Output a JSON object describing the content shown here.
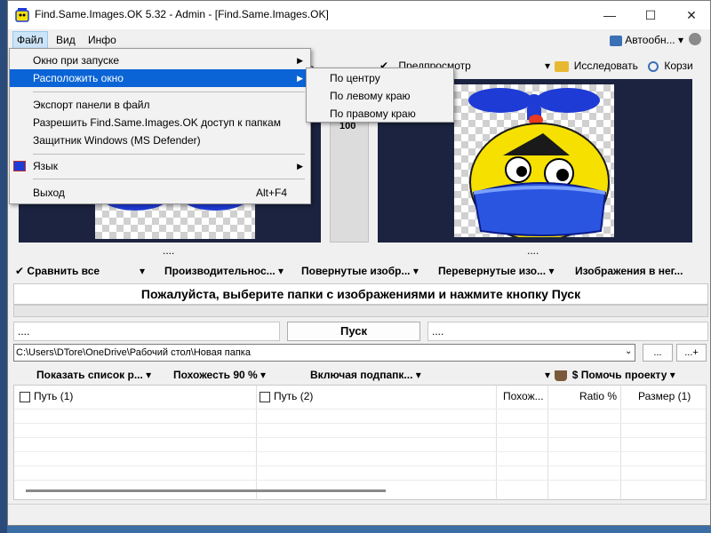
{
  "window": {
    "title": "Find.Same.Images.OK 5.32 - Admin - [Find.Same.Images.OK]"
  },
  "window_controls": {
    "minimize": "—",
    "maximize": "☐",
    "close": "✕"
  },
  "menubar": {
    "items": [
      "Файл",
      "Вид",
      "Инфо"
    ],
    "right": {
      "autoupdate_label": "Автообн...",
      "arrow": "▾"
    }
  },
  "toolbar": {
    "left_partial": "ь",
    "preview_check": "✔",
    "preview_label": "Предпросмотр",
    "explore_arrow": "▾",
    "explore_label": "Исследовать",
    "recycle_label": "Корзи"
  },
  "panels": {
    "left_dots": "....",
    "right_dots": "....",
    "middle_label": "100"
  },
  "options_bar": {
    "items": [
      {
        "label": "Сравнить все",
        "check": "✔"
      },
      {
        "label": "Производительнос..."
      },
      {
        "label": "Повернутые изобр..."
      },
      {
        "label": "Перевернутые изо..."
      },
      {
        "label": "Изображения в нег..."
      }
    ],
    "arrow": "▾"
  },
  "message": "Пожалуйста, выберите папки с изображениями и нажмите кнопку Пуск",
  "progress": {
    "value": 0
  },
  "start": {
    "left_dots": "....",
    "label": "Пуск",
    "right_dots": "...."
  },
  "path": {
    "value": "C:\\Users\\DTore\\OneDrive\\Рабочий стол\\Новая папка",
    "browse_label": "...",
    "add_label": "...+"
  },
  "list_options": {
    "show_list": "Показать список р...",
    "similarity": "Похожесть 90 %",
    "subfolders": "Включая подпапк...",
    "help_project": "$ Помочь проекту",
    "arrow": "▾"
  },
  "table": {
    "columns": [
      "Путь (1)",
      "Путь (2)",
      "Похож...",
      "Ratio %",
      "Размер (1)"
    ]
  },
  "file_menu": {
    "items": [
      {
        "label": "Окно при запуске",
        "submenu": true
      },
      {
        "label": "Расположить окно",
        "submenu": true,
        "highlighted": true
      },
      {
        "label": "Экспорт панели в файл"
      },
      {
        "label": "Разрешить Find.Same.Images.OK доступ к папкам"
      },
      {
        "label": "Защитник Windows (MS Defender)"
      },
      {
        "label": "Язык",
        "submenu": true
      },
      {
        "label": "Выход",
        "shortcut": "Alt+F4"
      }
    ],
    "arrow": "▶"
  },
  "position_submenu": {
    "items": [
      "По центру",
      "По левому краю",
      "По правому краю"
    ]
  },
  "colors": {
    "highlight": "#0a64d6",
    "panel_bg": "#1b2340",
    "character_yellow": "#ffee00",
    "character_blue": "#1f3bd6"
  }
}
